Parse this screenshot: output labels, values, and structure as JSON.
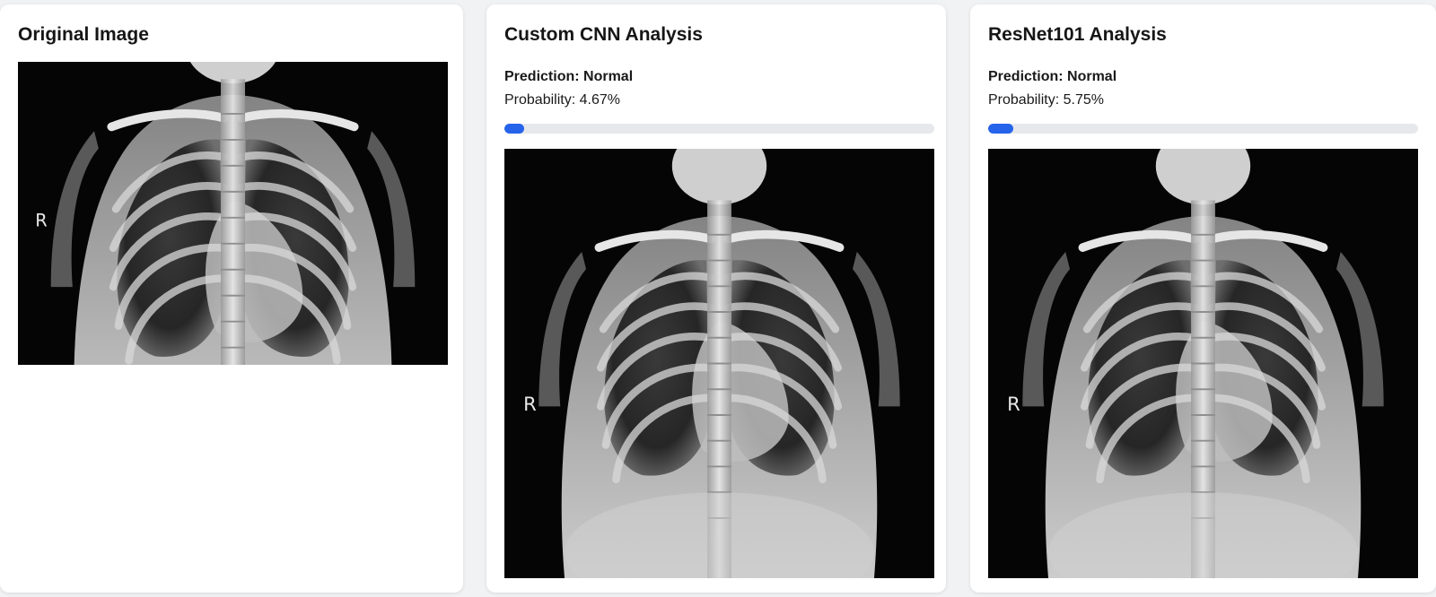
{
  "panels": [
    {
      "title": "Original Image",
      "image": {
        "icon": "chest-xray-image",
        "marker": "R"
      }
    },
    {
      "title": "Custom CNN Analysis",
      "prediction_label": "Prediction:",
      "prediction_value": "Normal",
      "probability_label": "Probability:",
      "probability_text": "4.67%",
      "probability_value": 4.67,
      "image": {
        "icon": "chest-xray-image",
        "marker": "R"
      }
    },
    {
      "title": "ResNet101 Analysis",
      "prediction_label": "Prediction:",
      "prediction_value": "Normal",
      "probability_label": "Probability:",
      "probability_text": "5.75%",
      "probability_value": 5.75,
      "image": {
        "icon": "chest-xray-image",
        "marker": "R"
      }
    }
  ],
  "colors": {
    "accent": "#2563eb",
    "track": "#e6e8ec",
    "background": "#f1f2f4",
    "card": "#ffffff"
  }
}
